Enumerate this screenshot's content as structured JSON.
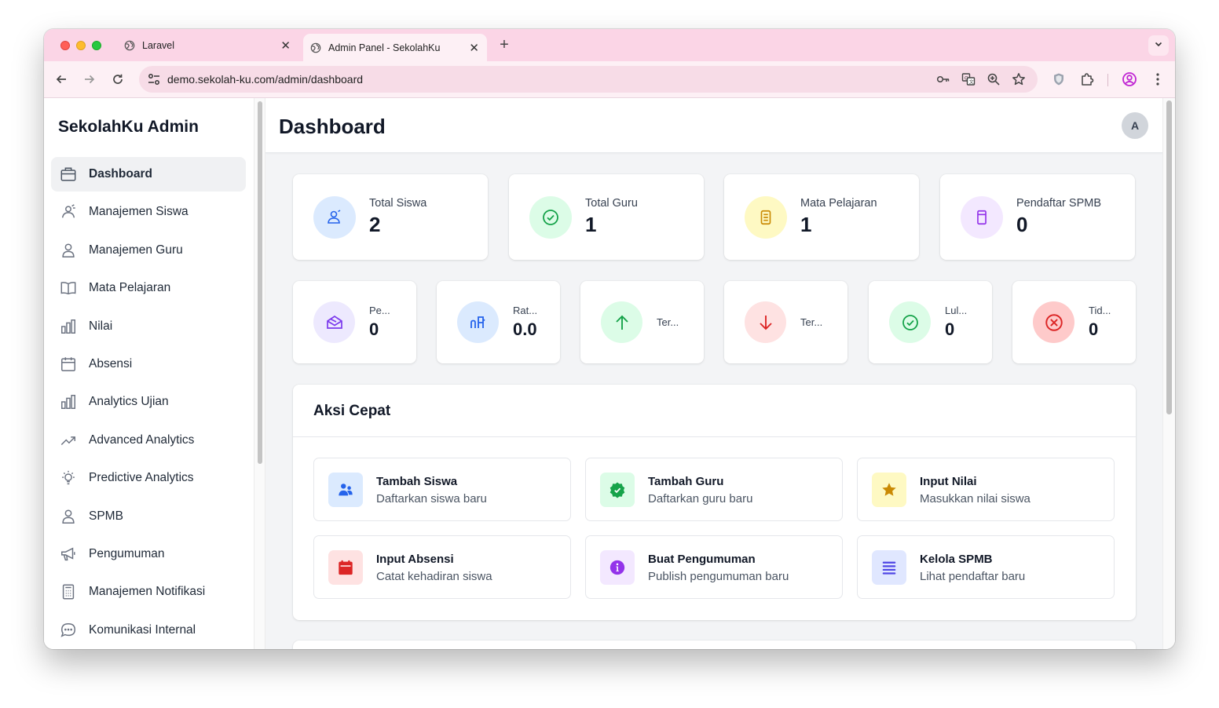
{
  "browser": {
    "tabs": [
      {
        "title": "Laravel",
        "active": false
      },
      {
        "title": "Admin Panel - SekolahKu",
        "active": true
      }
    ],
    "new_tab": "+",
    "url": "demo.sekolah-ku.com/admin/dashboard",
    "colors": {
      "tabstrip": "#fbd5e6",
      "toolbar": "#fdf0f5"
    }
  },
  "sidebar": {
    "brand": "SekolahKu Admin",
    "items": [
      {
        "label": "Dashboard",
        "icon": "briefcase-icon",
        "active": true
      },
      {
        "label": "Manajemen Siswa",
        "icon": "users-icon"
      },
      {
        "label": "Manajemen Guru",
        "icon": "user-icon"
      },
      {
        "label": "Mata Pelajaran",
        "icon": "book-open-icon"
      },
      {
        "label": "Nilai",
        "icon": "bar-chart-icon"
      },
      {
        "label": "Absensi",
        "icon": "calendar-icon"
      },
      {
        "label": "Analytics Ujian",
        "icon": "bar-chart-icon"
      },
      {
        "label": "Advanced Analytics",
        "icon": "trending-up-icon"
      },
      {
        "label": "Predictive Analytics",
        "icon": "lightbulb-icon"
      },
      {
        "label": "SPMB",
        "icon": "user-icon"
      },
      {
        "label": "Pengumuman",
        "icon": "megaphone-icon"
      },
      {
        "label": "Manajemen Notifikasi",
        "icon": "calculator-icon"
      },
      {
        "label": "Komunikasi Internal",
        "icon": "chat-icon"
      }
    ]
  },
  "header": {
    "title": "Dashboard",
    "avatar_initial": "A"
  },
  "stats": [
    {
      "label": "Total Siswa",
      "value": "2",
      "icon": "users-icon",
      "bg": "#dbeafe",
      "color": "#2563eb"
    },
    {
      "label": "Total Guru",
      "value": "1",
      "icon": "check-circle-icon",
      "bg": "#dcfce7",
      "color": "#16a34a"
    },
    {
      "label": "Mata Pelajaran",
      "value": "1",
      "icon": "document-icon",
      "bg": "#fef9c3",
      "color": "#ca8a04"
    },
    {
      "label": "Pendaftar SPMB",
      "value": "0",
      "icon": "clipboard-icon",
      "bg": "#f3e8ff",
      "color": "#9333ea"
    }
  ],
  "stats2": [
    {
      "label": "Pe...",
      "value": "0",
      "icon": "mail-open-icon",
      "bg": "#ede9fe",
      "color": "#7c3aed"
    },
    {
      "label": "Rat...",
      "value": "0.0",
      "icon": "chart-icon",
      "bg": "#dbeafe",
      "color": "#2563eb"
    },
    {
      "label": "Ter...",
      "value": "",
      "icon": "arrow-up-icon",
      "bg": "#dcfce7",
      "color": "#16a34a"
    },
    {
      "label": "Ter...",
      "value": "",
      "icon": "arrow-down-icon",
      "bg": "#fee2e2",
      "color": "#dc2626"
    },
    {
      "label": "Lul...",
      "value": "0",
      "icon": "check-circle-icon",
      "bg": "#dcfce7",
      "color": "#16a34a"
    },
    {
      "label": "Tid...",
      "value": "0",
      "icon": "x-circle-icon",
      "bg": "#fecaca",
      "color": "#dc2626"
    }
  ],
  "quick_actions": {
    "title": "Aksi Cepat",
    "items": [
      {
        "title": "Tambah Siswa",
        "subtitle": "Daftarkan siswa baru",
        "icon": "user-group-icon",
        "bg": "#dbeafe",
        "color": "#2563eb"
      },
      {
        "title": "Tambah Guru",
        "subtitle": "Daftarkan guru baru",
        "icon": "badge-check-icon",
        "bg": "#dcfce7",
        "color": "#16a34a"
      },
      {
        "title": "Input Nilai",
        "subtitle": "Masukkan nilai siswa",
        "icon": "star-icon",
        "bg": "#fef9c3",
        "color": "#ca8a04"
      },
      {
        "title": "Input Absensi",
        "subtitle": "Catat kehadiran siswa",
        "icon": "calendar-icon",
        "bg": "#fee2e2",
        "color": "#dc2626"
      },
      {
        "title": "Buat Pengumuman",
        "subtitle": "Publish pengumuman baru",
        "icon": "info-icon",
        "bg": "#f3e8ff",
        "color": "#9333ea"
      },
      {
        "title": "Kelola SPMB",
        "subtitle": "Lihat pendaftar baru",
        "icon": "list-icon",
        "bg": "#e0e7ff",
        "color": "#4f46e5"
      }
    ]
  }
}
